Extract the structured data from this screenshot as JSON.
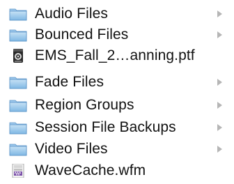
{
  "items": [
    {
      "label": "Audio Files",
      "kind": "folder",
      "icon": "folder-icon",
      "has_children": true
    },
    {
      "label": "Bounced Files",
      "kind": "folder",
      "icon": "folder-icon",
      "has_children": true
    },
    {
      "label": "EMS_Fall_2…anning.ptf",
      "kind": "session-file",
      "icon": "protools-session-icon",
      "has_children": false
    },
    {
      "label": "Fade Files",
      "kind": "folder",
      "icon": "folder-icon",
      "has_children": true
    },
    {
      "label": "Region Groups",
      "kind": "folder",
      "icon": "folder-icon",
      "has_children": true
    },
    {
      "label": "Session File Backups",
      "kind": "folder",
      "icon": "folder-icon",
      "has_children": true
    },
    {
      "label": "Video Files",
      "kind": "folder",
      "icon": "folder-icon",
      "has_children": true
    },
    {
      "label": "WaveCache.wfm",
      "kind": "cache-file",
      "icon": "wavecache-file-icon",
      "has_children": false
    }
  ],
  "colors": {
    "folder_top": "#c7e2f5",
    "folder_bottom": "#7fb7e4",
    "folder_edge": "#5a93c6",
    "chevron": "#b6b6b6",
    "text": "#111111"
  }
}
